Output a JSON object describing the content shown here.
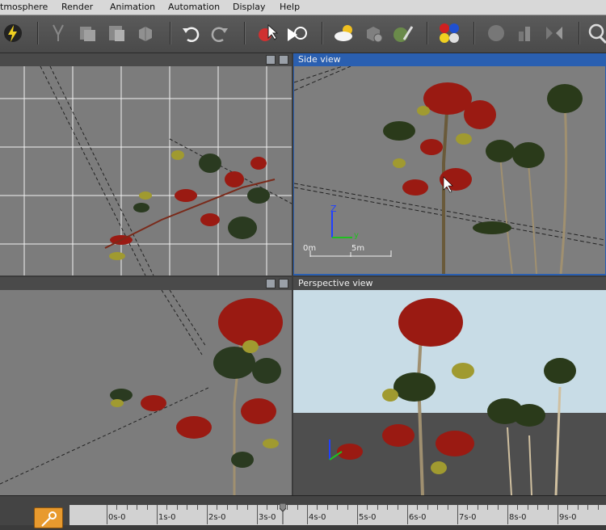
{
  "menu": [
    "tmosphere",
    "Render",
    "Animation",
    "Automation",
    "Display",
    "Help"
  ],
  "toolbar_icons": [
    "lightning-save-icon",
    "cut-icon",
    "copy-icon",
    "paste-icon",
    "objects-icon",
    "undo-icon",
    "redo-icon",
    "select-icon",
    "select-arrow-icon",
    "atmosphere-cloud-icon",
    "render-settings-icon",
    "plant-editor-icon",
    "material-balls-icon",
    "render-sphere-icon",
    "bar-icon",
    "mirror-icon",
    "zoom-icon"
  ],
  "viewports": {
    "top_left": {
      "title": ""
    },
    "side": {
      "title": "Side view",
      "scale_start": "0m",
      "scale_end": "5m",
      "axis_z": "Z",
      "axis_y": "y"
    },
    "bottom_left": {
      "title": ""
    },
    "perspective": {
      "title": "Perspective view"
    }
  },
  "timeline": {
    "labels": [
      "0s-0",
      "1s-0",
      "2s-0",
      "3s-0",
      "4s-0",
      "5s-0",
      "6s-0",
      "7s-0",
      "8s-0",
      "9s-0"
    ],
    "cursor_seconds": 3.5
  },
  "colors": {
    "active_view_header": "#2a5fb0",
    "key_button": "#e89a2e"
  }
}
